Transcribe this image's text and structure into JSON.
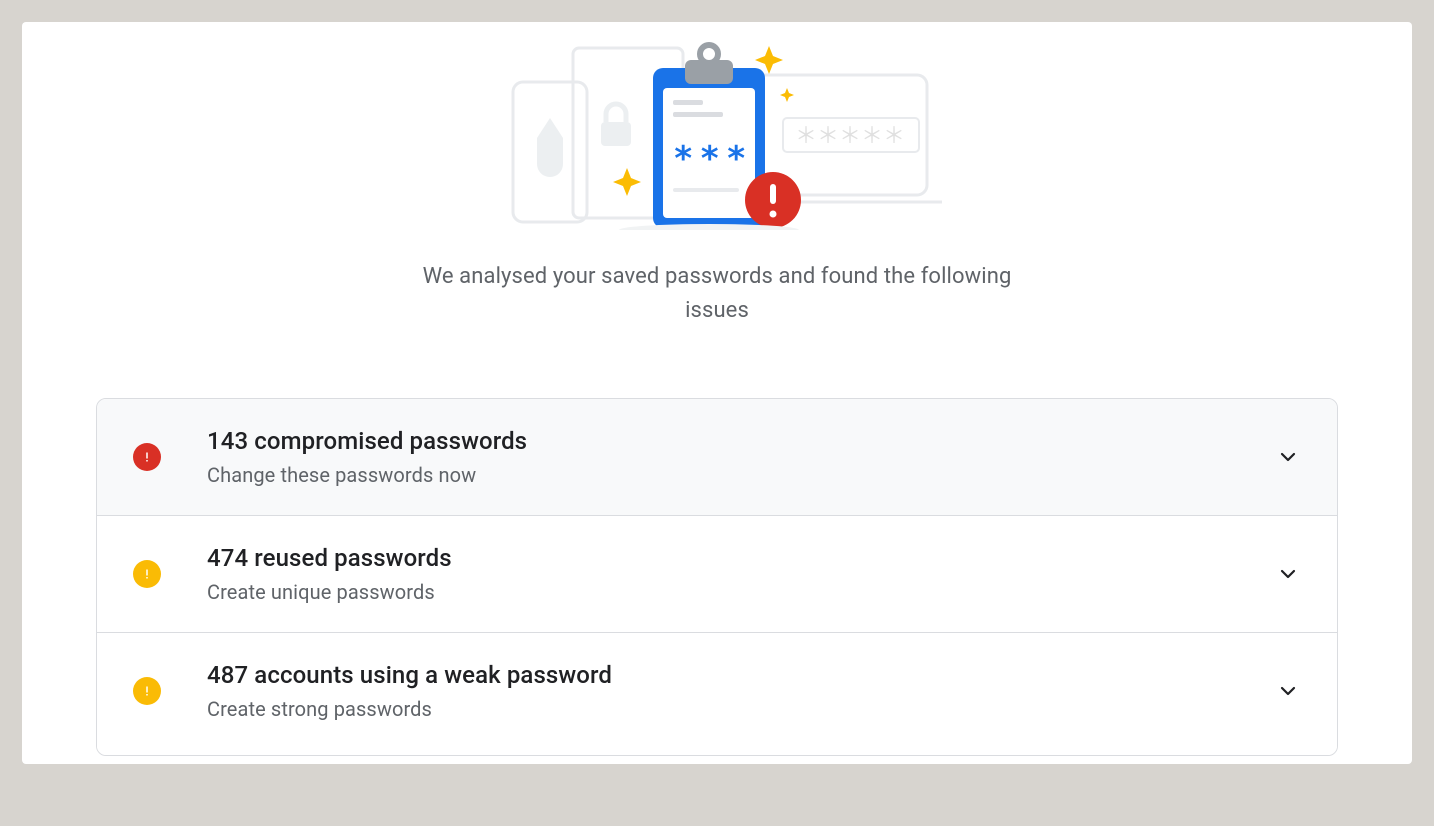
{
  "summary": "We analysed your saved passwords and found the following issues",
  "issues": [
    {
      "title": "143 compromised passwords",
      "subtitle": "Change these passwords now",
      "severity": "red"
    },
    {
      "title": "474 reused passwords",
      "subtitle": "Create unique passwords",
      "severity": "amber"
    },
    {
      "title": "487 accounts using a weak password",
      "subtitle": "Create strong passwords",
      "severity": "amber"
    }
  ]
}
